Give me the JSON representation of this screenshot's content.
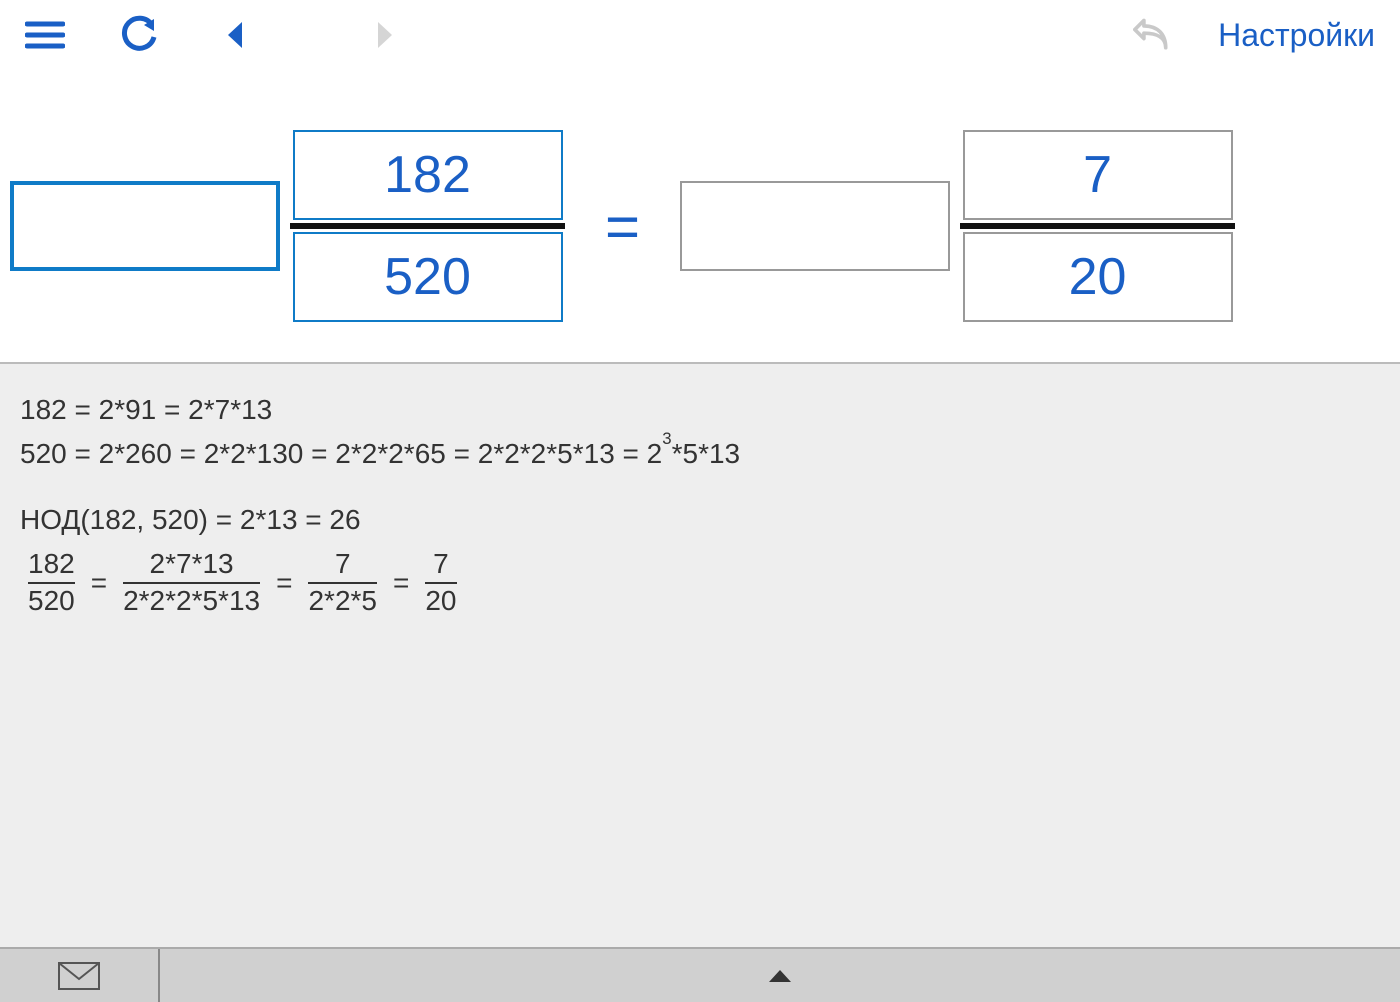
{
  "toolbar": {
    "icons": {
      "menu": "menu",
      "reload": "reload",
      "prev": "previous",
      "next": "next",
      "undo": "undo"
    },
    "settings_label": "Настройки"
  },
  "problem": {
    "left": {
      "whole": "",
      "numerator": "182",
      "denominator": "520",
      "selected": true
    },
    "right": {
      "whole": "",
      "numerator": "7",
      "denominator": "20",
      "selected": false
    },
    "equals": "="
  },
  "explanation": {
    "line1": "182 = 2*91 = 2*7*13",
    "line2": {
      "prefix": "520 = 2*260 = 2*2*130 = 2*2*2*65 = 2*2*2*5*13 = 2",
      "sup": "3",
      "suffix": "*5*13"
    },
    "gcd_line": "НОД(182, 520) = 2*13 = 26",
    "chain": [
      {
        "num": "182",
        "den": "520"
      },
      {
        "num": "2*7*13",
        "den": "2*2*2*5*13"
      },
      {
        "num": "7",
        "den": "2*2*5"
      },
      {
        "num": "7",
        "den": "20"
      }
    ],
    "eq": "="
  },
  "footer": {
    "mail_icon": "mail",
    "expand_icon": "expand-up"
  }
}
